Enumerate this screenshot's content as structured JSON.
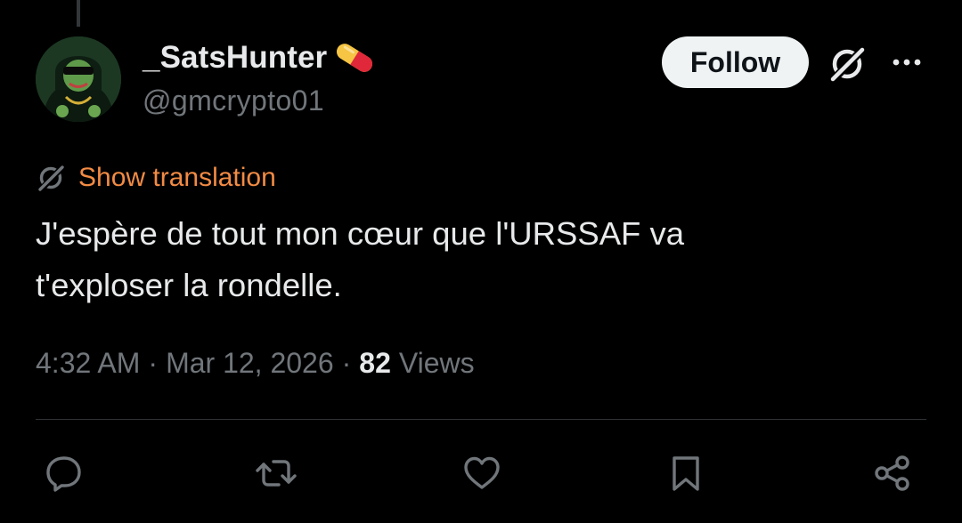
{
  "user": {
    "display_name": "_SatsHunter",
    "name_emoji": "pill-emoji",
    "handle": "@gmcrypto01"
  },
  "header": {
    "follow_label": "Follow",
    "grok_icon": "grok-icon",
    "more_icon": "more-icon"
  },
  "translation": {
    "icon": "translate-icon",
    "label": "Show translation"
  },
  "tweet": {
    "line1": "J'espère de tout mon cœur que l'URSSAF va",
    "line2": "t'exploser la rondelle."
  },
  "meta": {
    "time": "4:32 AM",
    "separator": "·",
    "date": "Mar 12, 2026",
    "views_count": "82",
    "views_label": "Views"
  },
  "actions": {
    "reply": "reply-icon",
    "retweet": "retweet-icon",
    "like": "like-icon",
    "bookmark": "bookmark-icon",
    "share": "share-icon"
  },
  "colors": {
    "background": "#000000",
    "text_primary": "#e7e9ea",
    "text_secondary": "#71767b",
    "translation_link": "#f28b44",
    "follow_bg": "#eff3f4",
    "follow_text": "#0f1419",
    "divider": "#2f3336",
    "pill_red": "#e0283a",
    "pill_yellow": "#f6c544"
  }
}
